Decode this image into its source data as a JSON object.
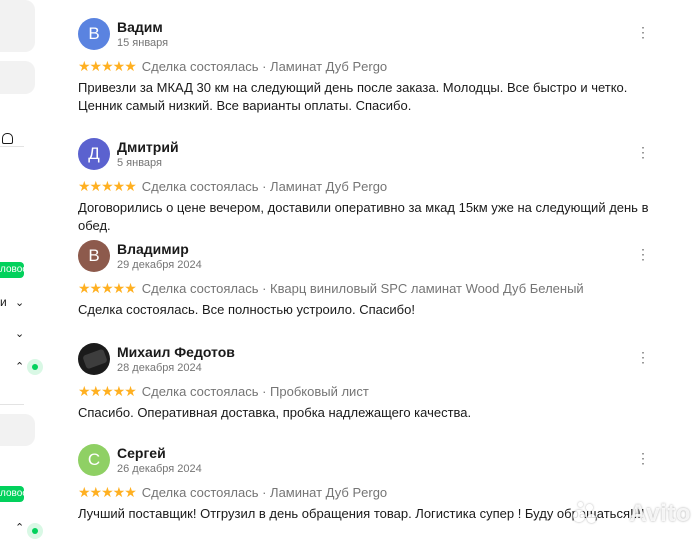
{
  "sidebar": {
    "badge_1": "ловое",
    "badge_2": "ловое",
    "item_fragment": "и"
  },
  "colors": {
    "star": "#ffb021",
    "avito_green": "#02d15c"
  },
  "reviews": [
    {
      "name": "Вадим",
      "date": "15 января",
      "avatar_letter": "В",
      "avatar_color": "#5a83e0",
      "stars": "★★★★★",
      "meta": "Сделка состоялась · Ламинат Дуб Pergo",
      "text": "Привезли за МКАД 30 км на следующий день после заказа. Молодцы. Все быстро и четко. Ценник самый низкий. Все варианты оплаты. Спасибо."
    },
    {
      "name": "Дмитрий",
      "date": "5 января",
      "avatar_letter": "Д",
      "avatar_color": "#5b62cf",
      "stars": "★★★★★",
      "meta": "Сделка состоялась · Ламинат Дуб Pergo",
      "text": "Договорились о цене вечером, доставили оперативно за мкад 15км уже на следующий день в обед."
    },
    {
      "name": "Владимир",
      "date": "29 декабря 2024",
      "avatar_letter": "В",
      "avatar_color": "#8d5a4c",
      "stars": "★★★★★",
      "meta": "Сделка состоялась · Кварц виниловый SPC ламинат Wood Дуб Беленый",
      "text": "Сделка состоялась. Все полностью устроило. Спасибо!"
    },
    {
      "name": "Михаил Федотов",
      "date": "28 декабря 2024",
      "avatar_letter": "",
      "avatar_color": "#1b1b1b",
      "stars": "★★★★★",
      "meta": "Сделка состоялась · Пробковый лист",
      "text": "Спасибо. Оперативная доставка, пробка надлежащего качества."
    },
    {
      "name": "Сергей",
      "date": "26 декабря 2024",
      "avatar_letter": "С",
      "avatar_color": "#8fd064",
      "stars": "★★★★★",
      "meta": "Сделка состоялась · Ламинат Дуб Pergo",
      "text": "Лучший поставщик! Отгрузил в день обращения товар. Логистика супер ! Буду обращаться!!!!"
    }
  ],
  "watermark": "Avito"
}
